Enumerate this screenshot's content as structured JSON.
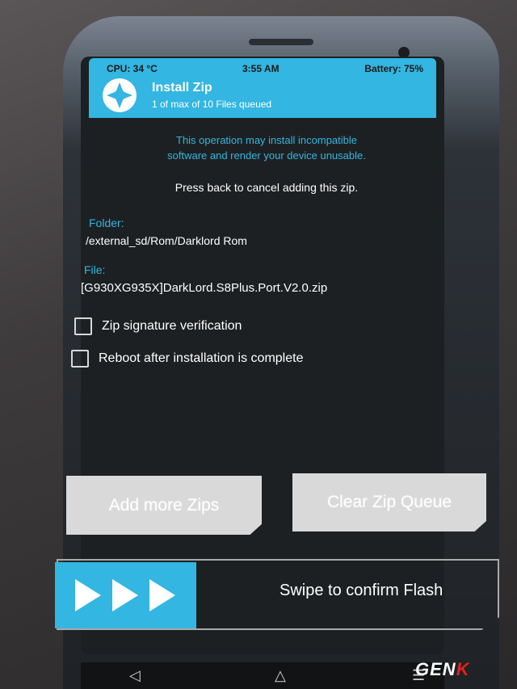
{
  "status": {
    "cpu": "CPU: 34 °C",
    "time": "3:55 AM",
    "battery": "Battery: 75%"
  },
  "header": {
    "title": "Install Zip",
    "subtitle": "1 of max of 10 Files queued",
    "logo_icon": "twrp-logo-icon"
  },
  "warning": {
    "line1": "This operation may install incompatible",
    "line2": "software and render your device unusable."
  },
  "press_back": "Press back to cancel adding this zip.",
  "folder": {
    "label": "Folder:",
    "value": "/external_sd/Rom/Darklord Rom"
  },
  "file": {
    "label": "File:",
    "value": "[G930XG935X]DarkLord.S8Plus.Port.V2.0.zip"
  },
  "options": [
    {
      "label": "Zip signature verification",
      "checked": false
    },
    {
      "label": "Reboot after installation is complete",
      "checked": false
    }
  ],
  "buttons": {
    "add_more": "Add more Zips",
    "clear_queue": "Clear Zip Queue"
  },
  "swipe": {
    "label": "Swipe to confirm Flash"
  },
  "watermark": {
    "text_main": "GEN",
    "text_accent": "K"
  },
  "colors": {
    "accent": "#33b6e1",
    "button_bg": "#d9d9d9",
    "screen_bg": "#1d2022"
  }
}
